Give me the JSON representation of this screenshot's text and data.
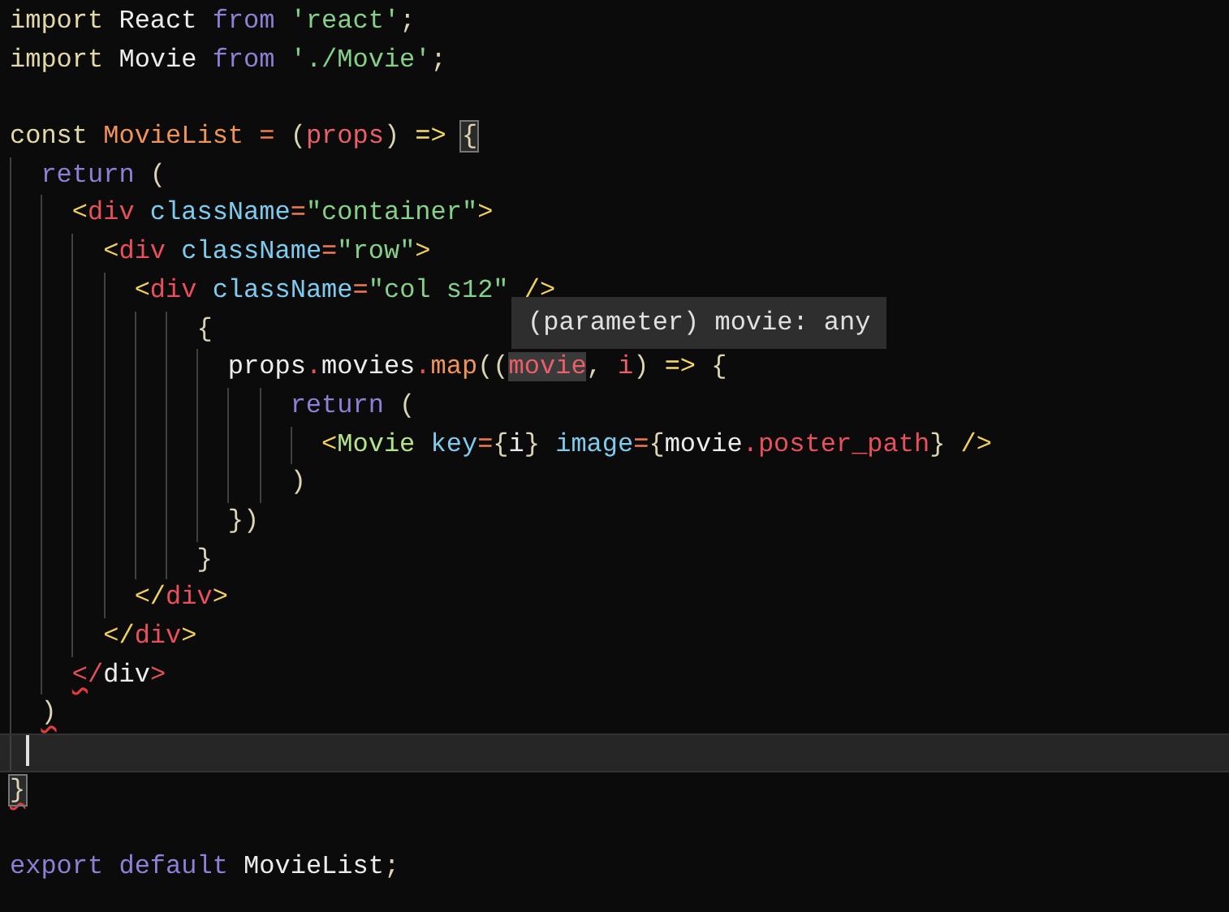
{
  "editor": {
    "lines": [
      {
        "tokens": [
          {
            "text": "import ",
            "kind": "keyword"
          },
          {
            "text": "React ",
            "kind": "plain"
          },
          {
            "text": "from ",
            "kind": "control"
          },
          {
            "text": "'react'",
            "kind": "string"
          },
          {
            "text": ";",
            "kind": "punct"
          }
        ]
      },
      {
        "tokens": [
          {
            "text": "import ",
            "kind": "keyword"
          },
          {
            "text": "Movie ",
            "kind": "plain"
          },
          {
            "text": "from ",
            "kind": "control"
          },
          {
            "text": "'./Movie'",
            "kind": "string"
          },
          {
            "text": ";",
            "kind": "punct"
          }
        ]
      },
      {
        "blank": true
      },
      {
        "tokens": [
          {
            "text": "const ",
            "kind": "keyword"
          },
          {
            "text": "MovieList ",
            "kind": "decl"
          },
          {
            "text": "= ",
            "kind": "operator"
          },
          {
            "text": "(",
            "kind": "punct"
          },
          {
            "text": "props",
            "kind": "param"
          },
          {
            "text": ") ",
            "kind": "punct"
          },
          {
            "text": "=> ",
            "kind": "arrow"
          },
          {
            "text": "{",
            "kind": "punct",
            "matched": true
          }
        ]
      },
      {
        "tokens": [
          {
            "text": "  return ",
            "kind": "control"
          },
          {
            "text": "(",
            "kind": "punct"
          }
        ]
      },
      {
        "tokens": [
          {
            "text": "    <",
            "kind": "tagmark"
          },
          {
            "text": "div ",
            "kind": "tag"
          },
          {
            "text": "className",
            "kind": "attr"
          },
          {
            "text": "=",
            "kind": "operator"
          },
          {
            "text": "\"container\"",
            "kind": "string"
          },
          {
            "text": ">",
            "kind": "tagmark"
          }
        ]
      },
      {
        "tokens": [
          {
            "text": "      <",
            "kind": "tagmark"
          },
          {
            "text": "div ",
            "kind": "tag"
          },
          {
            "text": "className",
            "kind": "attr"
          },
          {
            "text": "=",
            "kind": "operator"
          },
          {
            "text": "\"row\"",
            "kind": "string"
          },
          {
            "text": ">",
            "kind": "tagmark"
          }
        ]
      },
      {
        "tokens": [
          {
            "text": "        <",
            "kind": "tagmark"
          },
          {
            "text": "div ",
            "kind": "tag"
          },
          {
            "text": "className",
            "kind": "attr"
          },
          {
            "text": "=",
            "kind": "operator"
          },
          {
            "text": "\"col s12\" ",
            "kind": "string"
          },
          {
            "text": "/>",
            "kind": "tagmark"
          }
        ]
      },
      {
        "tokens": [
          {
            "text": "            {",
            "kind": "punct"
          }
        ]
      },
      {
        "tokens": [
          {
            "text": "              props",
            "kind": "plain"
          },
          {
            "text": ".",
            "kind": "property"
          },
          {
            "text": "movies",
            "kind": "plain"
          },
          {
            "text": ".",
            "kind": "property"
          },
          {
            "text": "map",
            "kind": "decl"
          },
          {
            "text": "((",
            "kind": "punct"
          },
          {
            "text": "movie",
            "kind": "param",
            "hovered": true
          },
          {
            "text": ", ",
            "kind": "punct"
          },
          {
            "text": "i",
            "kind": "param"
          },
          {
            "text": ") ",
            "kind": "punct"
          },
          {
            "text": "=> ",
            "kind": "arrow"
          },
          {
            "text": "{",
            "kind": "punct"
          }
        ]
      },
      {
        "tokens": [
          {
            "text": "                  return ",
            "kind": "control"
          },
          {
            "text": "(",
            "kind": "punct"
          }
        ]
      },
      {
        "tokens": [
          {
            "text": "                    <",
            "kind": "tagmark"
          },
          {
            "text": "Movie ",
            "kind": "component"
          },
          {
            "text": "key",
            "kind": "attr"
          },
          {
            "text": "=",
            "kind": "operator"
          },
          {
            "text": "{",
            "kind": "punct"
          },
          {
            "text": "i",
            "kind": "plain"
          },
          {
            "text": "} ",
            "kind": "punct"
          },
          {
            "text": "image",
            "kind": "attr"
          },
          {
            "text": "=",
            "kind": "operator"
          },
          {
            "text": "{",
            "kind": "punct"
          },
          {
            "text": "movie",
            "kind": "plain"
          },
          {
            "text": ".",
            "kind": "property"
          },
          {
            "text": "poster_path",
            "kind": "property"
          },
          {
            "text": "} ",
            "kind": "punct"
          },
          {
            "text": "/>",
            "kind": "tagmark"
          }
        ]
      },
      {
        "tokens": [
          {
            "text": "                  )",
            "kind": "punct"
          }
        ]
      },
      {
        "tokens": [
          {
            "text": "              })",
            "kind": "punct"
          }
        ]
      },
      {
        "tokens": [
          {
            "text": "            }",
            "kind": "punct"
          }
        ]
      },
      {
        "tokens": [
          {
            "text": "        </",
            "kind": "tagmark"
          },
          {
            "text": "div",
            "kind": "tag"
          },
          {
            "text": ">",
            "kind": "tagmark"
          }
        ]
      },
      {
        "tokens": [
          {
            "text": "      </",
            "kind": "tagmark"
          },
          {
            "text": "div",
            "kind": "tag"
          },
          {
            "text": ">",
            "kind": "tagmark"
          }
        ]
      },
      {
        "tokens": [
          {
            "text": "    <",
            "kind": "tag",
            "error": true
          },
          {
            "text": "/",
            "kind": "tag"
          },
          {
            "text": "div",
            "kind": "plain"
          },
          {
            "text": ">",
            "kind": "tag"
          }
        ]
      },
      {
        "tokens": [
          {
            "text": "  )",
            "kind": "punct",
            "error": true
          }
        ]
      },
      {
        "current": true
      },
      {
        "tokens": [
          {
            "text": "}",
            "kind": "punct",
            "matched": true,
            "error": true
          }
        ]
      },
      {
        "blank": true
      },
      {
        "tokens": [
          {
            "text": "export ",
            "kind": "control"
          },
          {
            "text": "default ",
            "kind": "control"
          },
          {
            "text": "MovieList",
            "kind": "plain"
          },
          {
            "text": ";",
            "kind": "punct"
          }
        ]
      }
    ],
    "tooltip": {
      "text": "(parameter) movie: any"
    }
  }
}
